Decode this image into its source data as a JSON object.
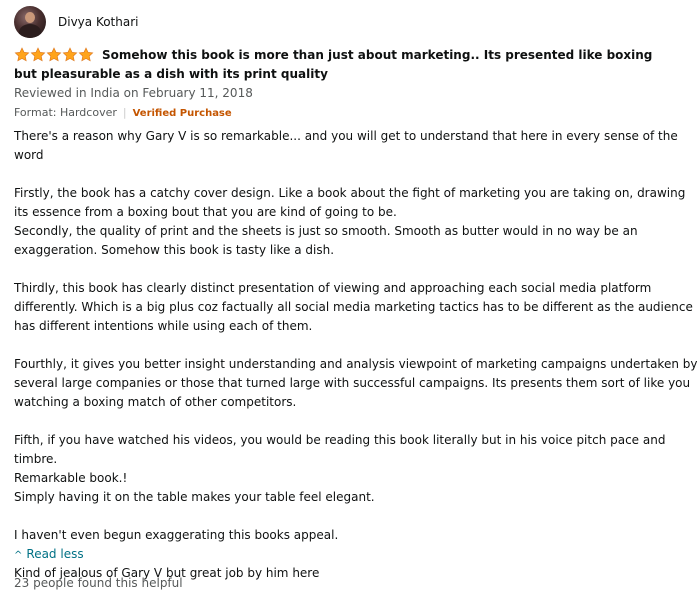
{
  "reviewer": {
    "name": "Divya Kothari"
  },
  "review": {
    "rating": 5,
    "star_color": "#ffa41c",
    "title": "Somehow this book is more than just about marketing.. Its presented like boxing but pleasurable as a dish with its print quality",
    "reviewed_in": "Reviewed in India on February 11, 2018",
    "format": "Format: Hardcover",
    "verified": "Verified Purchase",
    "paragraphs": [
      "There's a reason why Gary V is so remarkable... and you will get to understand that here in every sense of the word",
      "",
      "Firstly, the book has a catchy cover design. Like a book about the fight of marketing you are taking on, drawing its essence from a boxing bout that you are kind of going to be.",
      "Secondly, the quality of print and the sheets is just so smooth. Smooth as butter would in no way be an exaggeration. Somehow this book is tasty like a dish.",
      "",
      "Thirdly, this book has clearly distinct presentation of viewing and approaching each social media platform differently. Which is a big plus coz factually all social media marketing tactics has to be different as the audience has different intentions while using each of them.",
      "",
      "Fourthly, it gives you better insight understanding and analysis viewpoint of marketing campaigns undertaken by several large companies or those that turned large with successful campaigns. Its presents them sort of like you watching a boxing match of other competitors.",
      "",
      "Fifth, if you have watched his videos, you would be reading this book literally but in his voice pitch pace and timbre.",
      "Remarkable book.!",
      "Simply having it on the table makes your table feel elegant.",
      "",
      "I haven't even begun exaggerating this books appeal.",
      "",
      "Kind of jealous of Gary V but great job by him here"
    ],
    "read_less": "Read less",
    "helpful": "23 people found this helpful"
  }
}
